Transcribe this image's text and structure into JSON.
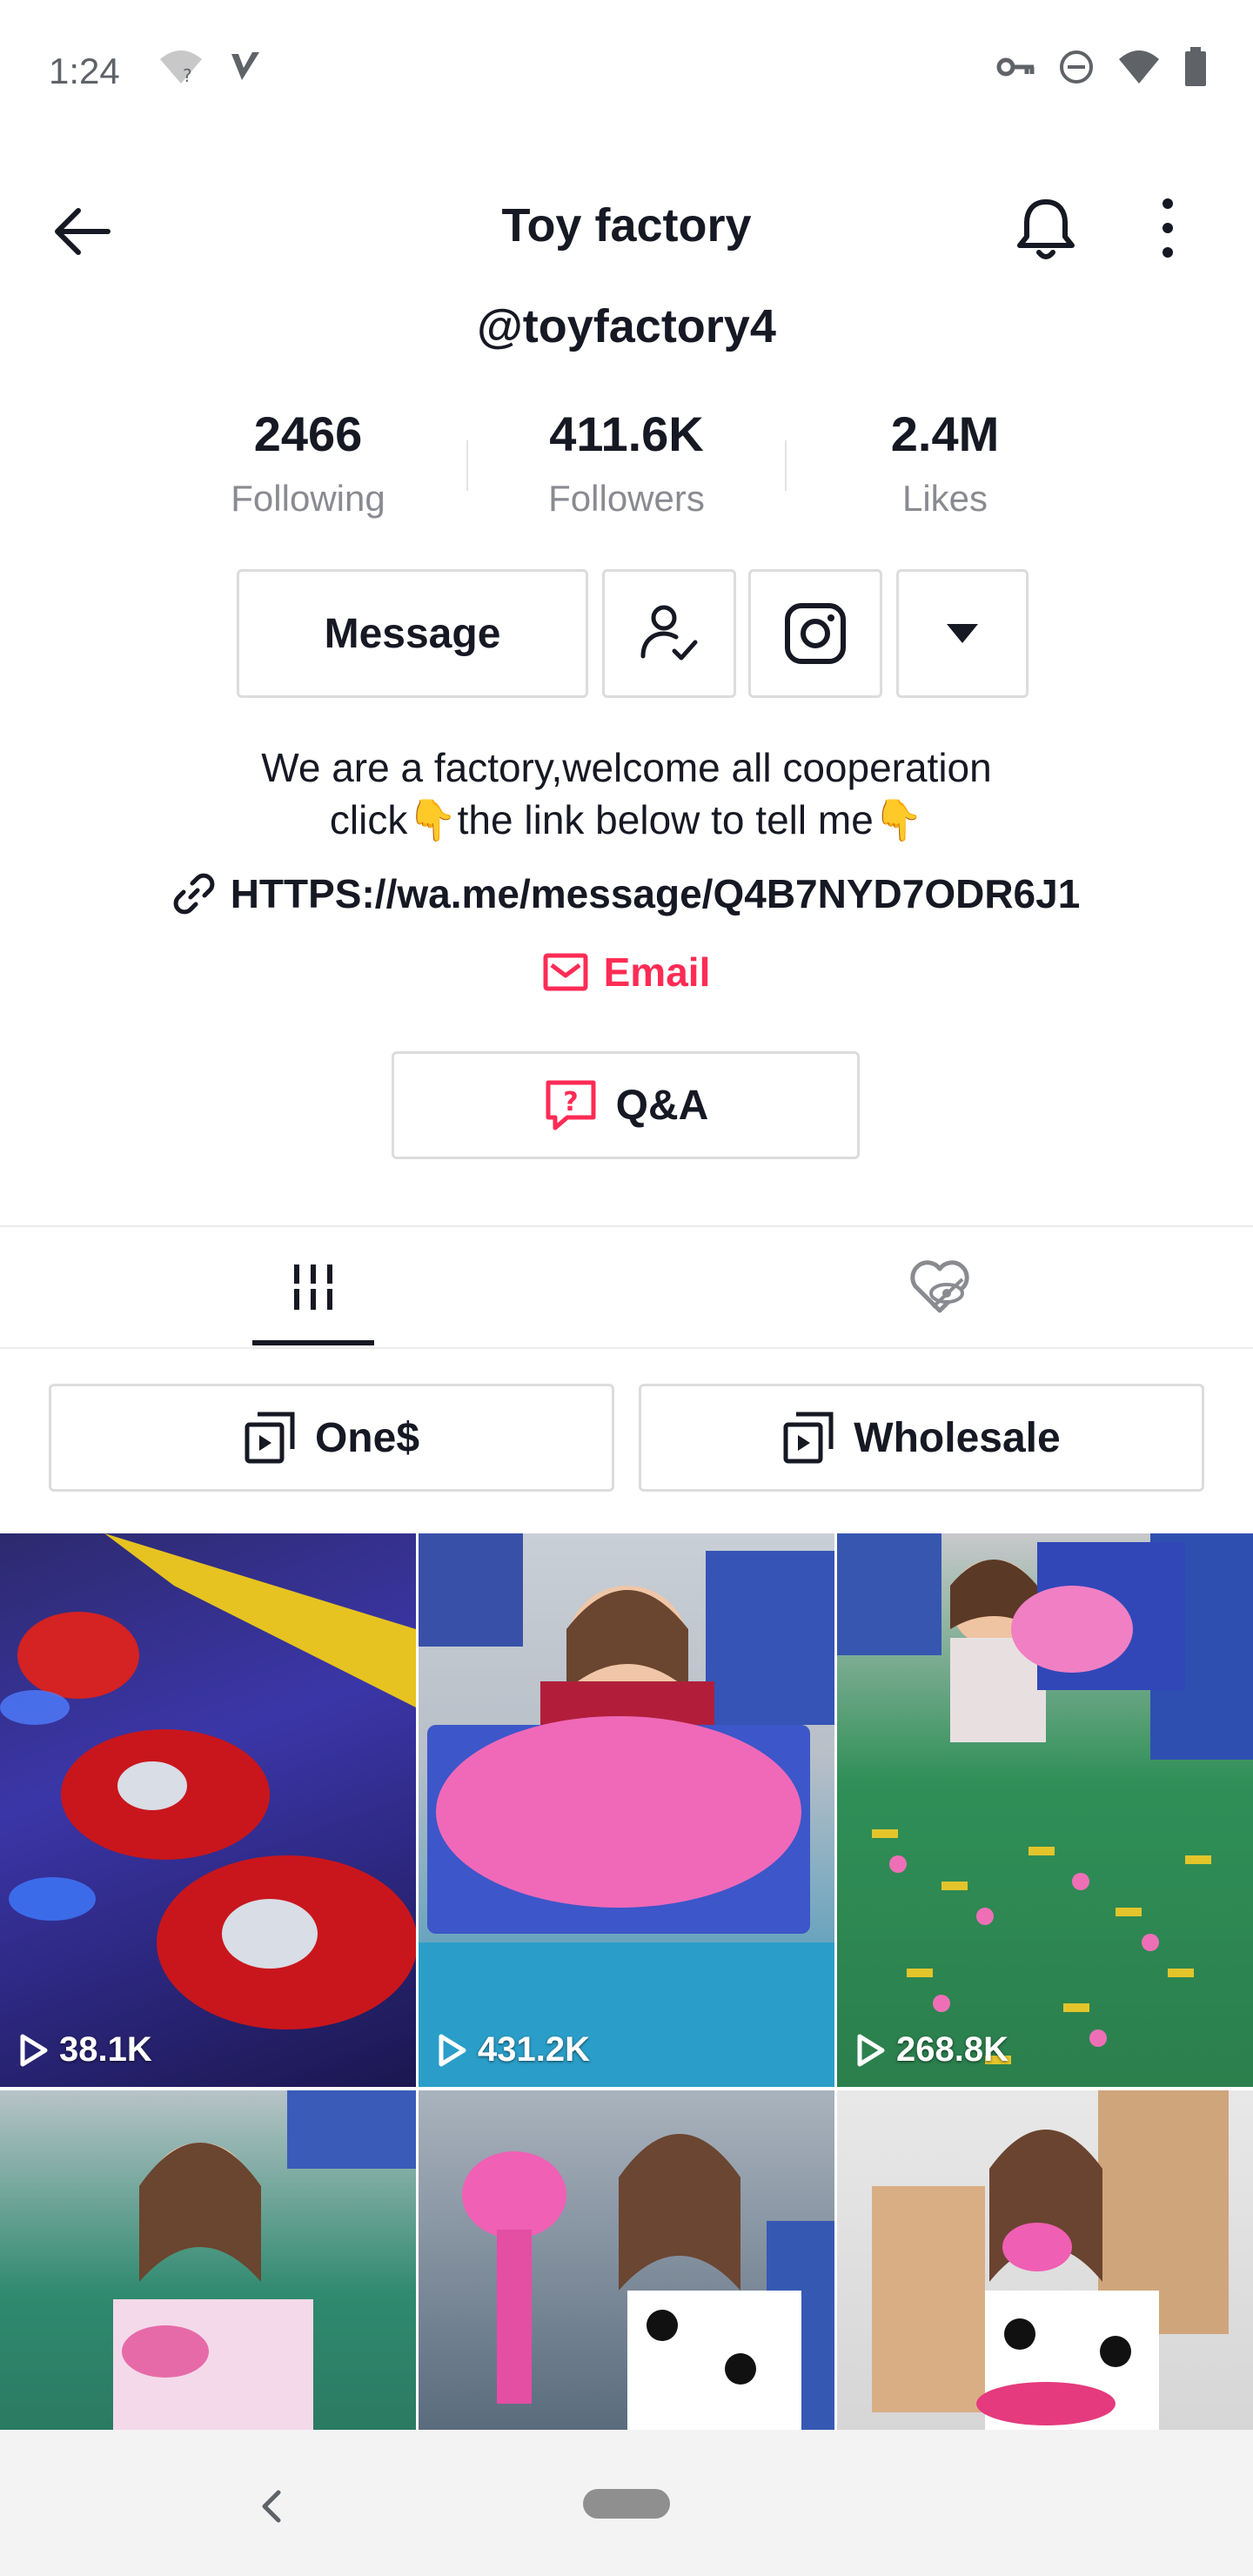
{
  "status_bar": {
    "time": "1:24",
    "icons_left": [
      "wifi-question-icon",
      "v-app-icon"
    ],
    "icons_right": [
      "vpn-key-icon",
      "dnd-icon",
      "signal-icon",
      "battery-icon"
    ]
  },
  "header": {
    "title": "Toy factory",
    "username": "@toyfactory4"
  },
  "stats": [
    {
      "value": "2466",
      "label": "Following"
    },
    {
      "value": "411.6K",
      "label": "Followers"
    },
    {
      "value": "2.4M",
      "label": "Likes"
    }
  ],
  "actions": {
    "message_label": "Message"
  },
  "bio": {
    "line1": "We are a factory,welcome all cooperation",
    "line2_a": "click",
    "line2_b": "the link below to tell me",
    "emoji": "👇",
    "link": "HTTPS://wa.me/message/Q4B7NYD7ODR6J1",
    "email_label": "Email"
  },
  "qa": {
    "label": "Q&A"
  },
  "playlists": [
    {
      "label": "One$"
    },
    {
      "label": "Wholesale"
    }
  ],
  "videos": [
    {
      "views": "38.1K",
      "theme": "red-helicopter-toys"
    },
    {
      "views": "431.2K",
      "theme": "pink-fairy-dolls"
    },
    {
      "views": "268.8K",
      "theme": "fairy-dolls-on-floor"
    },
    {
      "views": "",
      "theme": "woman-with-toy"
    },
    {
      "views": "",
      "theme": "woman-with-pink-fairy"
    },
    {
      "views": "",
      "theme": "woman-with-fairy-boxes"
    }
  ],
  "colors": {
    "accent": "#fe2c55",
    "text": "#161823",
    "muted": "#8a8b91",
    "border": "#dcdcdc"
  }
}
